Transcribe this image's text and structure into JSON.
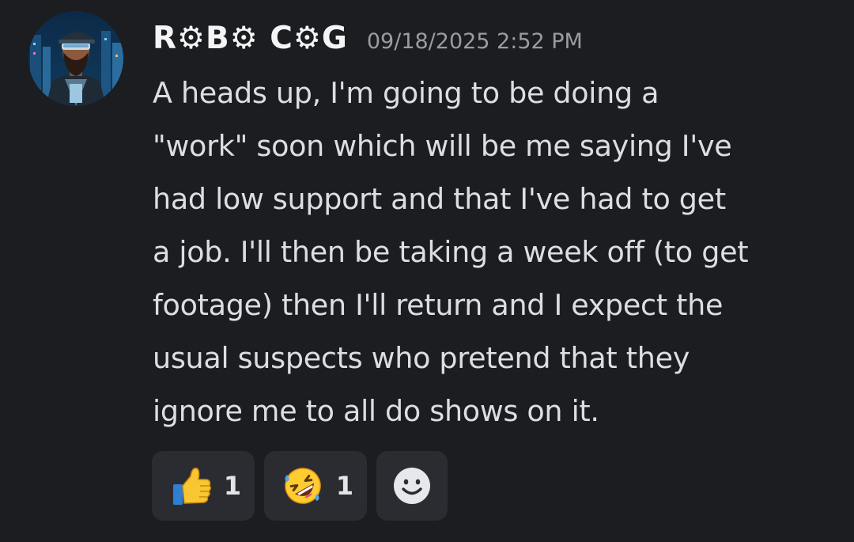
{
  "message": {
    "username": "R⚙B⚙ C⚙G",
    "timestamp": "09/18/2025 2:52 PM",
    "content_lines": [
      "A heads up, I'm going to be doing a",
      "\"work\" soon which will be me saying I've",
      "had low support and that I've had to get",
      "a job. I'll then be taking a week off (to get",
      "footage) then I'll return and I expect the",
      "usual suspects who pretend that they",
      "ignore me to all do shows on it."
    ]
  },
  "reactions": [
    {
      "emoji": "thumbs-up",
      "count": "1"
    },
    {
      "emoji": "rolling-on-the-floor-laughing",
      "count": "1"
    }
  ],
  "add_reaction": {
    "icon": "smiley-face-icon"
  },
  "colors": {
    "background": "#1c1d21",
    "reaction_bg": "#2b2c31",
    "username": "#f4f4f6",
    "timestamp": "#9b9ca3",
    "text": "#dddee2"
  }
}
